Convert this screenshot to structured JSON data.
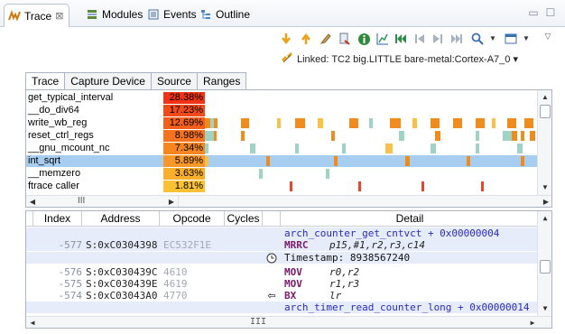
{
  "view_tabs": [
    {
      "label": "Trace",
      "icon": "trace-icon",
      "active": true,
      "close": "⊠"
    },
    {
      "label": "Modules",
      "icon": "modules-icon",
      "active": false
    },
    {
      "label": "Events",
      "icon": "events-icon",
      "active": false
    },
    {
      "label": "Outline",
      "icon": "outline-icon",
      "active": false
    }
  ],
  "window_controls": {
    "minimize": "▭",
    "maximize": "☐"
  },
  "toolbar": {
    "icons": [
      "download-arrow-icon",
      "upload-arrow-icon",
      "pencil-icon",
      "export-icon",
      "info-icon",
      "chart-icon",
      "first-icon",
      "step-back-icon",
      "step-forward-icon",
      "last-icon",
      "search-icon",
      "dropdown-icon",
      "view-menu-icon"
    ]
  },
  "linked": {
    "text": "Linked: TC2 big.LITTLE bare-metal:Cortex-A7_0 ▾"
  },
  "subtabs": [
    "Trace",
    "Capture Device",
    "Source",
    "Ranges"
  ],
  "functions": [
    {
      "name": "get_typical_interval",
      "pct": "28.38%",
      "color": "#f03216"
    },
    {
      "name": "__do_div64",
      "pct": "17.23%",
      "color": "#f24a18"
    },
    {
      "name": "write_wb_reg",
      "pct": "12.69%",
      "color": "#f4601c"
    },
    {
      "name": "reset_ctrl_regs",
      "pct": "8.98%",
      "color": "#f5721f"
    },
    {
      "name": "__gnu_mcount_nc",
      "pct": "7.34%",
      "color": "#f7861f"
    },
    {
      "name": "int_sqrt",
      "pct": "5.89%",
      "color": "#f79828",
      "selected": true
    },
    {
      "name": "__memzero",
      "pct": "3.63%",
      "color": "#f9ae2c"
    },
    {
      "name": "ftrace caller",
      "pct": "1.81%",
      "color": "#fac232"
    }
  ],
  "timeline_colors": {
    "orange": "#f08c1e",
    "yellow": "#f6c24a",
    "teal": "#9ed3c6",
    "red": "#e8452a"
  },
  "hscroll_grip": "III",
  "columns": [
    "Index",
    "Address",
    "Opcode",
    "Cycles",
    "Detail"
  ],
  "rows": [
    {
      "type": "symbol",
      "text": "arch_counter_get_cntvct + 0x00000004"
    },
    {
      "type": "instr",
      "index": "-577",
      "address": "S:0xC0304398",
      "opcode": "EC532F1E",
      "mnemonic": "MRRC",
      "operands": "p15,#1,r2,r3,c14"
    },
    {
      "type": "timestamp",
      "text": "Timestamp: 8938567240"
    },
    {
      "type": "instr",
      "index": "-576",
      "address": "S:0xC030439C",
      "opcode": "4610",
      "mnemonic": "MOV",
      "operands": "r0,r2"
    },
    {
      "type": "instr",
      "index": "-575",
      "address": "S:0xC030439E",
      "opcode": "4619",
      "mnemonic": "MOV",
      "operands": "r1,r3"
    },
    {
      "type": "instr",
      "index": "-574",
      "address": "S:0xC03043A0",
      "opcode": "4770",
      "mnemonic": "BX",
      "operands": "lr",
      "marker": "⇦"
    },
    {
      "type": "symbol",
      "text": "arch_timer_read_counter_long + 0x00000014"
    }
  ]
}
